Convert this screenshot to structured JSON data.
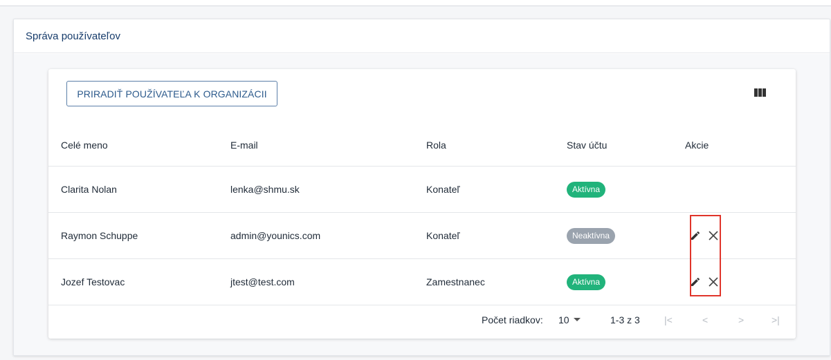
{
  "page": {
    "title": "Správa používateľov"
  },
  "toolbar": {
    "assign_label": "PRIRADIŤ POUŽÍVATEĽA K ORGANIZÁCII",
    "columns_icon": "view-column-icon"
  },
  "table": {
    "headers": [
      "Celé meno",
      "E-mail",
      "Rola",
      "Stav účtu",
      "Akcie"
    ],
    "rows": [
      {
        "name": "Clarita Nolan",
        "email": "lenka@shmu.sk",
        "role": "Konateľ",
        "status": "Aktívna",
        "status_kind": "active",
        "actions": []
      },
      {
        "name": "Raymon Schuppe",
        "email": "admin@younics.com",
        "role": "Konateľ",
        "status": "Neaktívna",
        "status_kind": "inactive",
        "actions": [
          "edit",
          "remove"
        ]
      },
      {
        "name": "Jozef Testovac",
        "email": "jtest@test.com",
        "role": "Zamestnanec",
        "status": "Aktívna",
        "status_kind": "active",
        "actions": [
          "edit",
          "remove"
        ]
      }
    ]
  },
  "pagination": {
    "rows_label": "Počet riadkov:",
    "rows_value": "10",
    "range": "1-3 z 3",
    "first": "|<",
    "prev": "<",
    "next": ">",
    "last": ">|"
  },
  "colors": {
    "active": "#21b37b",
    "inactive": "#9aa3ae",
    "highlight": "#e0342a",
    "accent": "#2c5a8c"
  }
}
